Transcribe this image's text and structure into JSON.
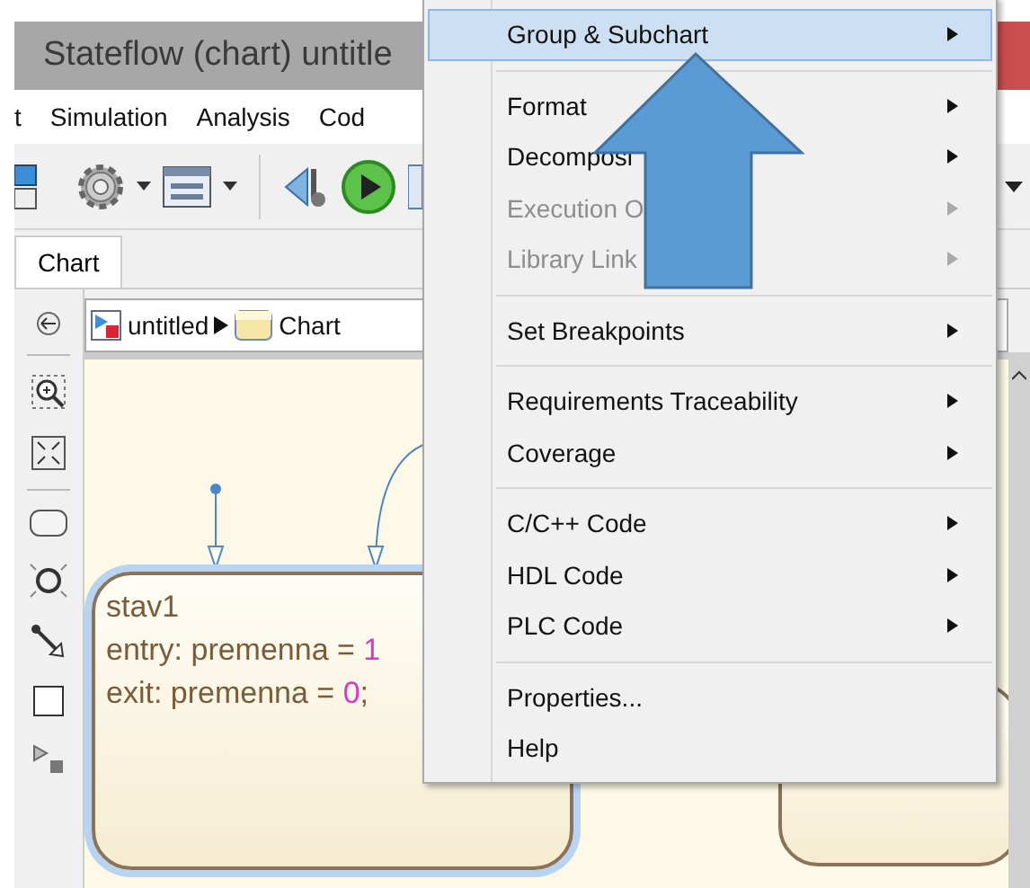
{
  "window": {
    "title": "Stateflow (chart) untitle"
  },
  "menu_bar": [
    "t",
    "Simulation",
    "Analysis",
    "Cod"
  ],
  "tabs": [
    {
      "label": "Chart",
      "selected": true
    }
  ],
  "breadcrumb": [
    "untitled",
    "Chart"
  ],
  "state": {
    "name": "stav1",
    "selected": true,
    "lines": [
      {
        "text": "entry: premenna = ",
        "value": "1"
      },
      {
        "text": "exit: premenna = ",
        "value": "0",
        "end": ";"
      }
    ]
  },
  "context_menu": {
    "sections": [
      [
        {
          "label": "Group & Subchart",
          "selected": true,
          "disabled": false,
          "submenu": true
        }
      ],
      [
        {
          "label": "Format",
          "selected": false,
          "disabled": false,
          "submenu": true
        },
        {
          "label": "Decomposi",
          "selected": false,
          "disabled": false,
          "submenu": true
        },
        {
          "label": "Execution O",
          "selected": false,
          "disabled": true,
          "submenu": true
        },
        {
          "label": "Library Link",
          "selected": false,
          "disabled": true,
          "submenu": true
        }
      ],
      [
        {
          "label": "Set Breakpoints",
          "selected": false,
          "disabled": false,
          "submenu": true
        }
      ],
      [
        {
          "label": "Requirements Traceability",
          "selected": false,
          "disabled": false,
          "submenu": true
        },
        {
          "label": "Coverage",
          "selected": false,
          "disabled": false,
          "submenu": true
        }
      ],
      [
        {
          "label": "C/C++ Code",
          "selected": false,
          "disabled": false,
          "submenu": true
        },
        {
          "label": "HDL Code",
          "selected": false,
          "disabled": false,
          "submenu": true
        },
        {
          "label": "PLC Code",
          "selected": false,
          "disabled": false,
          "submenu": true
        }
      ],
      [
        {
          "label": "Properties...",
          "selected": false,
          "disabled": false,
          "submenu": false
        },
        {
          "label": "Help",
          "selected": false,
          "disabled": false,
          "submenu": false
        }
      ]
    ]
  }
}
